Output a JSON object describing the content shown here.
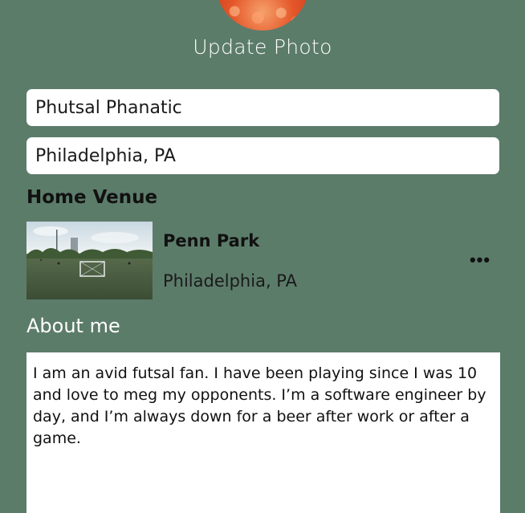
{
  "profile": {
    "update_photo_label": "Update Photo",
    "name_value": "Phutsal Phanatic",
    "location_value": "Philadelphia, PA"
  },
  "home_venue": {
    "heading": "Home Venue",
    "name": "Penn Park",
    "city": "Philadelphia, PA",
    "more_icon": "more-horizontal-icon",
    "more_label": "•••"
  },
  "about": {
    "heading": "About me",
    "text": "I am an avid futsal fan. I have been playing since I was 10 and love to meg my opponents. I’m a software engineer by day, and I’m always down for a beer after work or after a game."
  },
  "colors": {
    "background": "#5c7c6a",
    "field_background": "#ffffff",
    "heading_text": "#111111",
    "light_text": "#ffffff"
  }
}
